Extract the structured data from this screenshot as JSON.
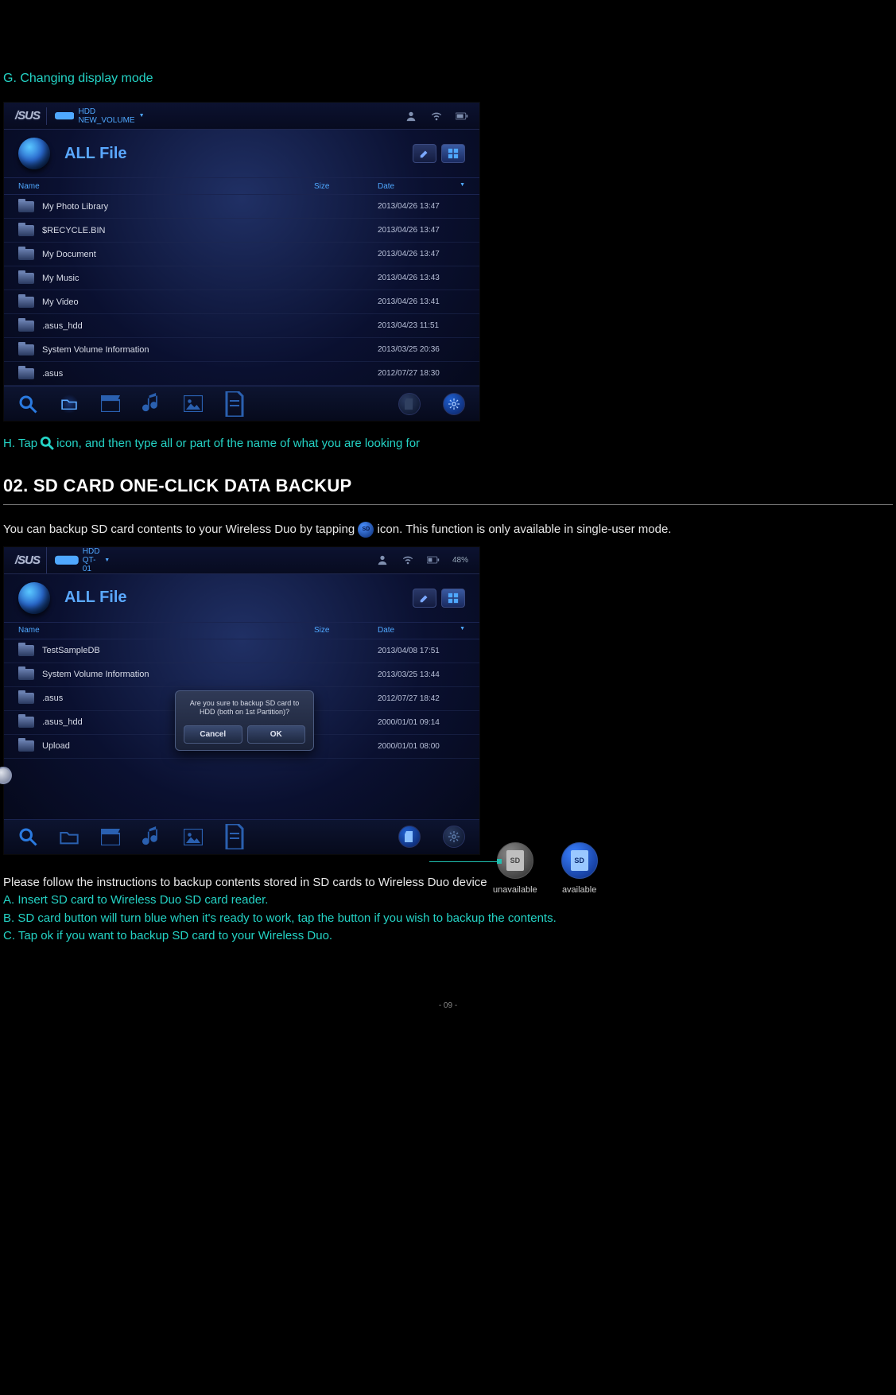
{
  "section_g_title": "G. Changing display mode",
  "screenshot1": {
    "logo": "/SUS",
    "volume": "HDD NEW_VOLUME",
    "title": "ALL File",
    "columns": {
      "name": "Name",
      "size": "Size",
      "date": "Date"
    },
    "rows": [
      {
        "name": "My Photo Library",
        "date": "2013/04/26 13:47"
      },
      {
        "name": "$RECYCLE.BIN",
        "date": "2013/04/26 13:47"
      },
      {
        "name": "My Document",
        "date": "2013/04/26 13:47"
      },
      {
        "name": "My Music",
        "date": "2013/04/26 13:43"
      },
      {
        "name": "My Video",
        "date": "2013/04/26 13:41"
      },
      {
        "name": ".asus_hdd",
        "date": "2013/04/23 11:51"
      },
      {
        "name": "System Volume Information",
        "date": "2013/03/25 20:36"
      },
      {
        "name": ".asus",
        "date": "2012/07/27 18:30"
      }
    ]
  },
  "h_line_pre": "H. Tap",
  "h_line_post": "icon, and then type all or part of the name of what you are looking for",
  "sec02_title": "02. SD CARD ONE-CLICK DATA BACKUP",
  "body_pre": "You can backup SD card contents to your Wireless Duo by tapping",
  "body_post": "icon. This function is only available in single-user mode.",
  "screenshot2": {
    "logo": "/SUS",
    "volume": "HDD QT-01",
    "battery": "48%",
    "title": "ALL File",
    "columns": {
      "name": "Name",
      "size": "Size",
      "date": "Date"
    },
    "rows": [
      {
        "name": "TestSampleDB",
        "date": "2013/04/08 17:51"
      },
      {
        "name": "System Volume Information",
        "date": "2013/03/25 13:44"
      },
      {
        "name": ".asus",
        "date": "2012/07/27 18:42"
      },
      {
        "name": ".asus_hdd",
        "date": "2000/01/01 09:14"
      },
      {
        "name": "Upload",
        "date": "2000/01/01 08:00"
      }
    ],
    "dialog": {
      "message": "Are you sure to backup SD card to HDD (both on 1st Partition)?",
      "cancel": "Cancel",
      "ok": "OK"
    }
  },
  "sd_legend": {
    "unavailable": "unavailable",
    "available": "available",
    "sd": "SD"
  },
  "instructions": {
    "lead": "Please follow the instructions to backup contents stored in SD cards to Wireless Duo device",
    "a": "A. Insert SD card to Wireless Duo SD card reader.",
    "b": "B. SD card button will turn blue when it's ready to work, tap the button if you wish to backup the contents.",
    "c": "C. Tap ok if you want to backup SD card to your Wireless Duo."
  },
  "page_num": "- 09 -"
}
